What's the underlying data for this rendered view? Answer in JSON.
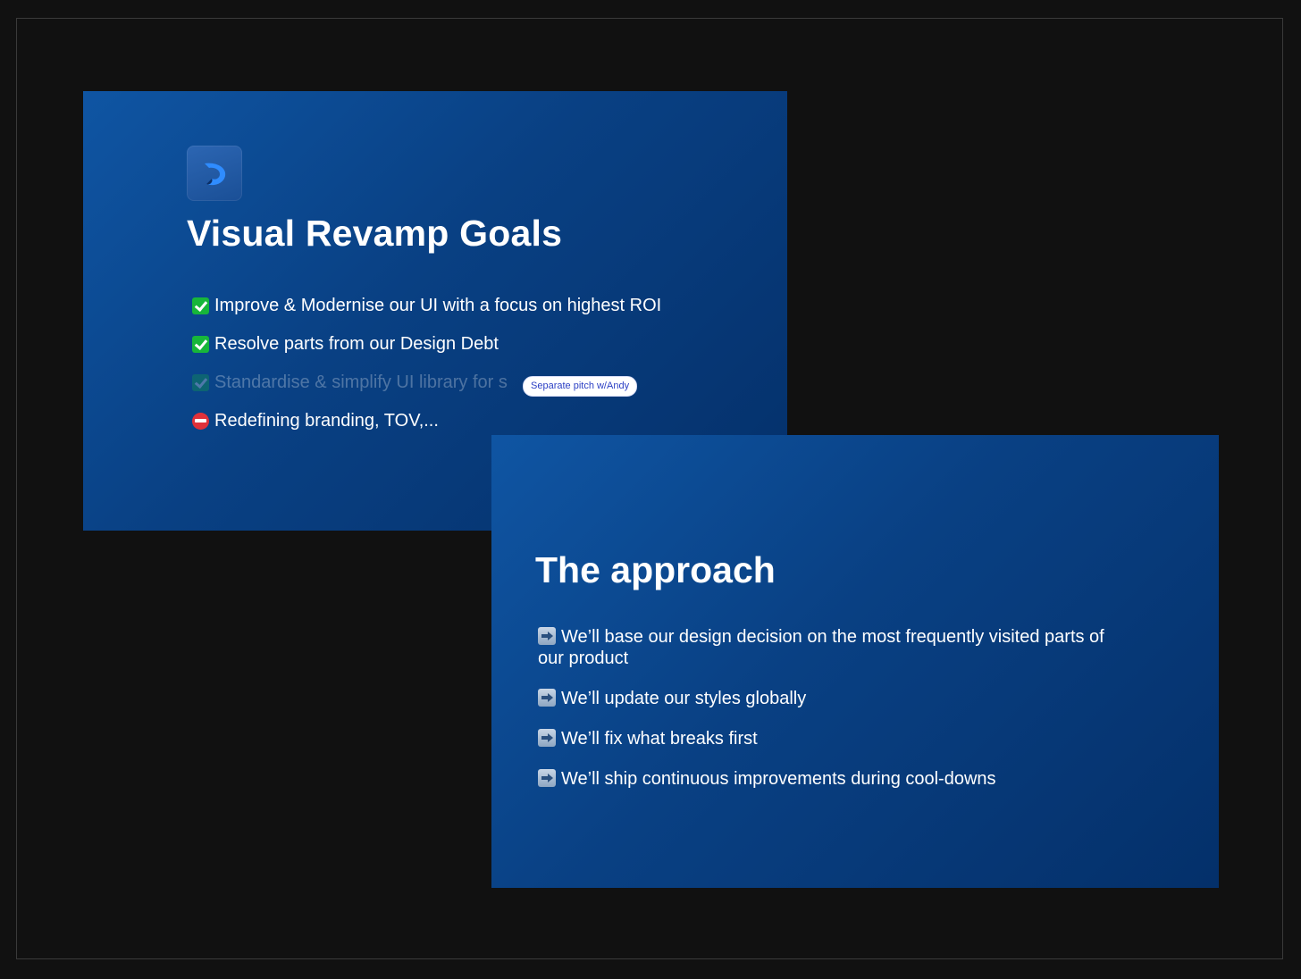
{
  "slide_goals": {
    "title": "Visual Revamp Goals",
    "logo_icon": "brand-logo-icon",
    "goals": [
      {
        "icon": "check-mark-icon",
        "text": "Improve & Modernise our UI with a focus on highest ROI"
      },
      {
        "icon": "check-mark-icon",
        "text": "Resolve parts from our Design Debt"
      },
      {
        "icon": "check-mark-icon",
        "text": "Standardise & simplify UI library for s"
      },
      {
        "icon": "no-entry-icon",
        "text": "Redefining branding, TOV,..."
      }
    ],
    "comment_pill": "Separate pitch w/Andy"
  },
  "slide_approach": {
    "title": "The approach",
    "steps": [
      {
        "icon": "right-arrow-icon",
        "text": "We’ll base our design decision on the most frequently visited parts of our product"
      },
      {
        "icon": "right-arrow-icon",
        "text": "We’ll update our styles globally"
      },
      {
        "icon": "right-arrow-icon",
        "text": "We’ll fix what breaks first"
      },
      {
        "icon": "right-arrow-icon",
        "text": "We’ll ship continuous improvements during cool-downs"
      }
    ]
  },
  "colors": {
    "page_background": "#111111",
    "slide_gradient_start": "#0f55a3",
    "slide_gradient_end": "#04306a",
    "check_green": "#17b63a",
    "no_entry_red": "#e0313a",
    "pill_text": "#2b3fc4"
  }
}
